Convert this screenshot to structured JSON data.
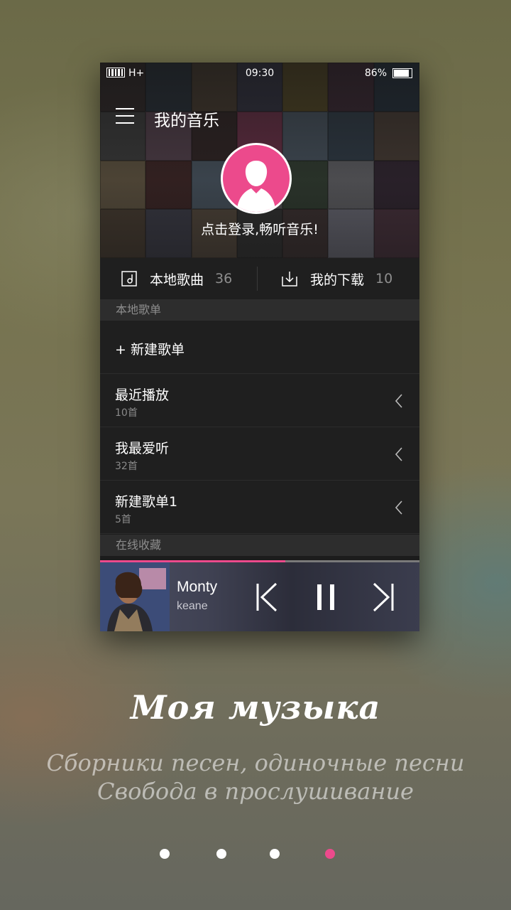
{
  "status_bar": {
    "network": "H+",
    "time": "09:30",
    "battery": "86%",
    "battery_level": 0.86
  },
  "header": {
    "title": "我的音乐",
    "login_prompt": "点击登录,畅听音乐!"
  },
  "quick_access": [
    {
      "label": "本地歌曲",
      "count": "36",
      "icon": "local-music-icon"
    },
    {
      "label": "我的下载",
      "count": "10",
      "icon": "download-icon"
    }
  ],
  "sections": {
    "local_playlists": "本地歌单",
    "online_favorites": "在线收藏"
  },
  "new_playlist_label": "+ 新建歌单",
  "playlists": [
    {
      "title": "最近播放",
      "count": "10首"
    },
    {
      "title": "我最爱听",
      "count": "32首"
    },
    {
      "title": "新建歌单1",
      "count": "5首"
    }
  ],
  "player": {
    "song": "Monty",
    "artist": "keane",
    "progress": 0.58
  },
  "promo": {
    "title": "Моя музыка",
    "line1": "Сборники песен, одиночные песни",
    "line2": "Свобода в прослушивание"
  },
  "pager": {
    "count": 4,
    "active": 3
  },
  "colors": {
    "accent": "#ec4a8c",
    "panel": "#1f1f1f",
    "section": "#2d2d2d"
  }
}
